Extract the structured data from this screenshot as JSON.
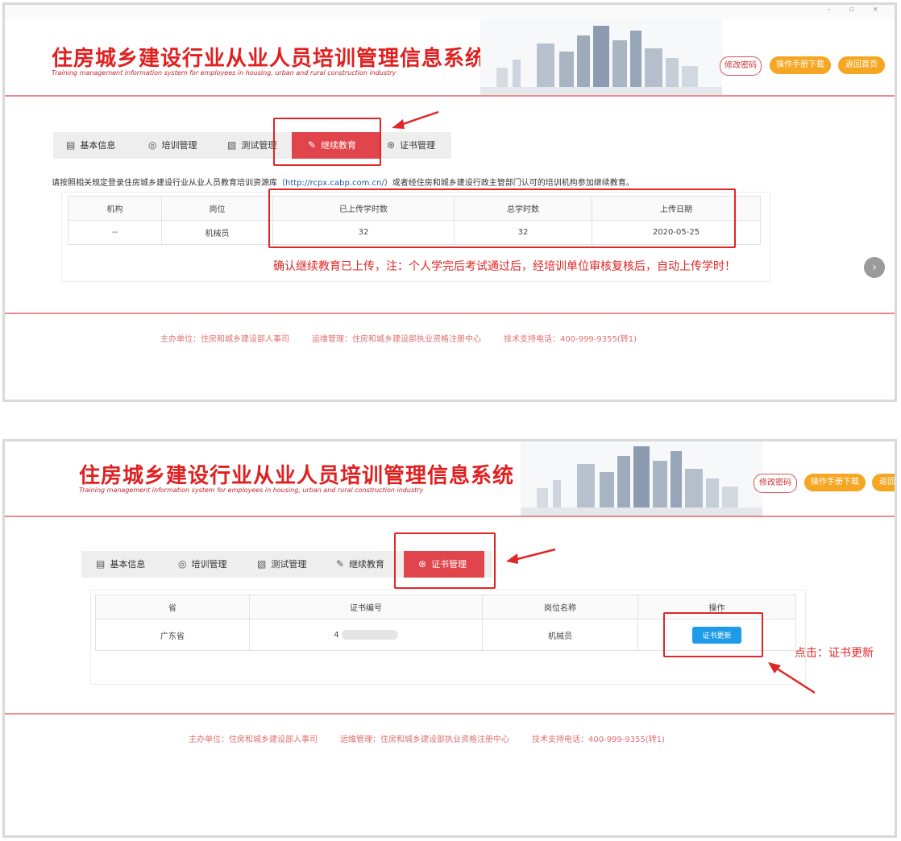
{
  "window": {
    "controls": "– ▫ ×"
  },
  "header": {
    "title": "住房城乡建设行业从业人员培训管理信息系统",
    "subtitle": "Training management information system for employees in housing, urban and rural construction industry",
    "buttons": [
      "修改密码",
      "操作手册下载",
      "返回首页"
    ]
  },
  "panel1": {
    "tabs": [
      {
        "label": "基本信息",
        "icon": "clipboard-icon"
      },
      {
        "label": "培训管理",
        "icon": "chat-icon"
      },
      {
        "label": "测试管理",
        "icon": "edit-doc-icon"
      },
      {
        "label": "继续教育",
        "icon": "pencil-doc-icon",
        "active": true
      },
      {
        "label": "证书管理",
        "icon": "certificate-icon"
      }
    ],
    "notice_pre": "请按照相关规定登录住房城乡建设行业从业人员教育培训资源库（",
    "notice_link": "http://rcpx.cabp.com.cn/",
    "notice_post": "）或者经住房和城乡建设行政主管部门认可的培训机构参加继续教育。",
    "table": {
      "headers": [
        "机构",
        "岗位",
        "已上传学时数",
        "总学时数",
        "上传日期"
      ],
      "rows": [
        [
          "--",
          "机械员",
          "32",
          "32",
          "2020-05-25"
        ]
      ]
    },
    "annotation": "确认继续教育已上传，注：个人学完后考试通过后，经培训单位审核复核后，自动上传学时！",
    "next_glyph": "›"
  },
  "footer": {
    "host": "主办单位：住房和城乡建设部人事司",
    "ops": "运维管理：住房和城乡建设部执业资格注册中心",
    "support": "技术支持电话：400-999-9355(转1)"
  },
  "panel2": {
    "tabs": [
      {
        "label": "基本信息",
        "icon": "clipboard-icon"
      },
      {
        "label": "培训管理",
        "icon": "chat-icon"
      },
      {
        "label": "测试管理",
        "icon": "edit-doc-icon"
      },
      {
        "label": "继续教育",
        "icon": "pencil-doc-icon"
      },
      {
        "label": "证书管理",
        "icon": "certificate-icon",
        "active": true
      }
    ],
    "table": {
      "headers": [
        "省",
        "证书编号",
        "岗位名称",
        "操作"
      ],
      "rows": [
        [
          "广东省",
          "4",
          "机械员",
          "证书更新"
        ]
      ]
    },
    "annotation": "点击：证书更新"
  },
  "colors": {
    "brand_red": "#e02020",
    "tab_active": "#e0454c",
    "accent_orange": "#f5a623",
    "link_blue": "#1e9be8",
    "annotation_red": "#e02626"
  }
}
